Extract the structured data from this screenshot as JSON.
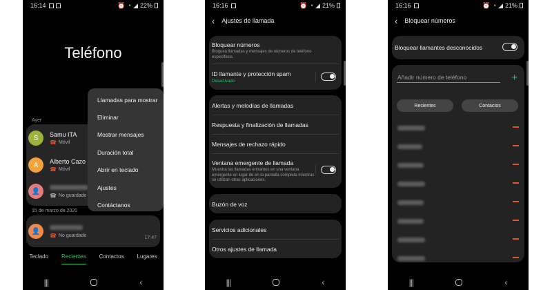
{
  "screen1": {
    "status": {
      "time": "16:14",
      "battery": "22%"
    },
    "title": "Teléfono",
    "section_yesterday": "Ayer",
    "section_march": "15 de marzo de 2020",
    "contacts": [
      {
        "initial": "S",
        "name": "Samu ITA",
        "sub": "Móvil",
        "color": "green"
      },
      {
        "initial": "A",
        "name": "Alberto Cazo",
        "sub": "Móvil",
        "color": "orange"
      },
      {
        "initial": "",
        "name": "",
        "sub": "No guardado",
        "color": "pink"
      },
      {
        "initial": "",
        "name": "",
        "sub": "No guardado",
        "time": "17:47",
        "color": "orange2"
      }
    ],
    "menu": [
      "Llamadas para mostrar",
      "Eliminar",
      "Mostrar mensajes",
      "Duración total",
      "Abrir en teclado",
      "Ajustes",
      "Contáctanos"
    ],
    "tabs": [
      "Teclado",
      "Recientes",
      "Contactos",
      "Lugares"
    ],
    "active_tab": "Recientes"
  },
  "screen2": {
    "status": {
      "time": "16:16",
      "battery": "21%"
    },
    "title": "Ajustes de llamada",
    "block_title": "Bloquear números",
    "block_desc": "Bloquea llamadas y mensajes de números de teléfono específicos.",
    "callerid_title": "ID llamante y protección spam",
    "callerid_status": "Desactivado",
    "alerts": "Alertas y melodías de llamadas",
    "answer": "Respuesta y finalización de llamadas",
    "reject": "Mensajes de rechazo rápido",
    "popup_title": "Ventana emergente de llamada",
    "popup_desc": "Muestra las llamadas entrantes en una ventana emergente en lugar de en la pantalla completa mientras se utilizan otras aplicaciones.",
    "voicemail": "Buzón de voz",
    "additional": "Servicios adicionales",
    "other": "Otros ajustes de llamada"
  },
  "screen3": {
    "status": {
      "time": "16:16",
      "battery": "21%"
    },
    "title": "Bloquear números",
    "unknown_label": "Bloquear llamantes desconocidos",
    "input_placeholder": "Añadir número de teléfono",
    "btn_recent": "Recientes",
    "btn_contacts": "Contactos",
    "blocked_count": 9
  },
  "colors": {
    "accent": "#2cbf6c",
    "remove": "#e2542b",
    "card": "#262626"
  }
}
